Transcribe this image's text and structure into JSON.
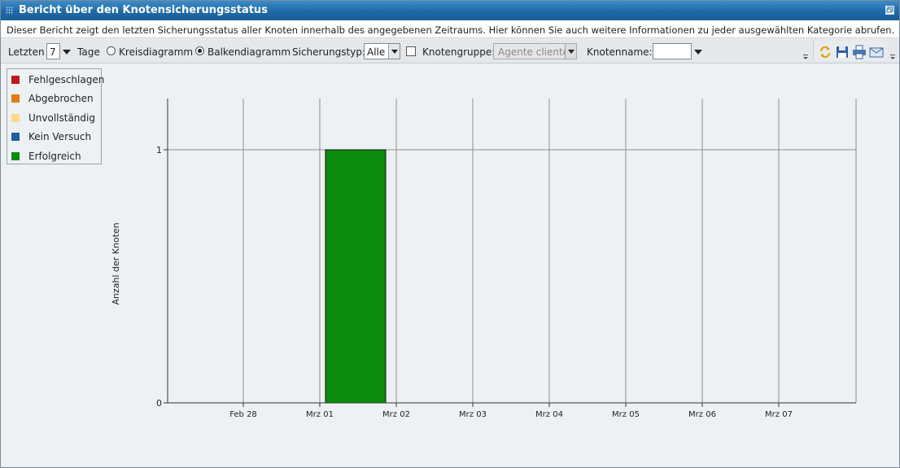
{
  "window": {
    "title": "Bericht über den Knotensicherungsstatus"
  },
  "description": "Dieser Bericht zeigt den letzten Sicherungsstatus aller Knoten innerhalb des angegebenen Zeitraums. Hier können Sie auch weitere Informationen zu jeder ausgewählten Kategorie abrufen.",
  "toolbar": {
    "last_label": "Letzten",
    "days_value": "7",
    "days_label": "Tage",
    "pie_label": "Kreisdiagramm",
    "bar_label": "Balkendiagramm",
    "selected_view": "bar",
    "backup_type_label": "Sicherungstyp:",
    "backup_type_value": "Alle",
    "node_group_checked": false,
    "node_group_label": "Knotengruppe:",
    "node_group_value": "Agente cliente",
    "node_name_label": "Knotenname:",
    "node_name_value": "",
    "icons": [
      "refresh-icon",
      "save-icon",
      "print-icon",
      "email-icon"
    ]
  },
  "legend": [
    {
      "label": "Fehlgeschlagen",
      "color": "#c0171b"
    },
    {
      "label": "Abgebrochen",
      "color": "#e07a12"
    },
    {
      "label": "Unvollständig",
      "color": "#fbd98a"
    },
    {
      "label": "Kein Versuch",
      "color": "#1a5fa0"
    },
    {
      "label": "Erfolgreich",
      "color": "#0c8c0c"
    }
  ],
  "chart_data": {
    "type": "bar",
    "ylabel": "Anzahl der Knoten",
    "xlabel": "",
    "categories": [
      "Feb 28",
      "Mrz 01",
      "Mrz 02",
      "Mrz 03",
      "Mrz 04",
      "Mrz 05",
      "Mrz 06",
      "Mrz 07"
    ],
    "ylim": [
      0,
      1
    ],
    "yticks": [
      "0",
      "1"
    ],
    "grid": true,
    "series": [
      {
        "name": "Erfolgreich",
        "color": "#0c8c0c",
        "values": [
          0,
          1,
          0,
          0,
          0,
          0,
          0,
          0
        ]
      }
    ]
  }
}
